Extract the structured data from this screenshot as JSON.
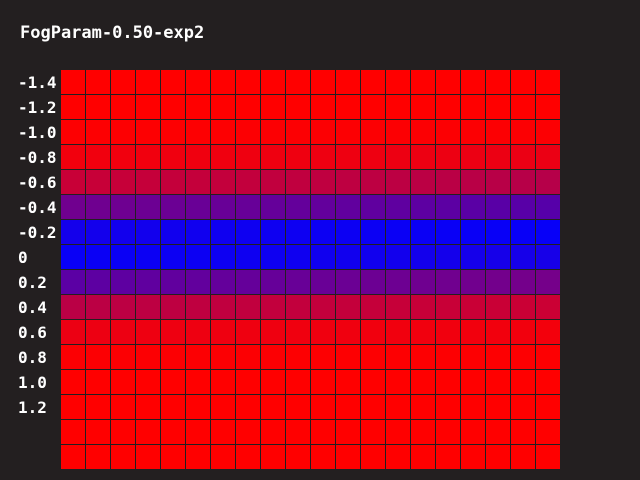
{
  "title": "FogParam-0.50-exp2",
  "row_labels": [
    "-1.4",
    "-1.2",
    "-1.0",
    "-0.8",
    "-0.6",
    "-0.4",
    "-0.2",
    "0",
    "0.2",
    "0.4",
    "0.6",
    "0.8",
    "1.0",
    "1.2",
    "",
    ""
  ],
  "grid": {
    "columns": 20,
    "rows": 16
  },
  "colors": {
    "fog_color": "#ff0000",
    "object_color": "#0000ff",
    "background": "#231f20",
    "text": "#ffffff"
  },
  "fog": {
    "density": 0.5,
    "mode": "exp2"
  }
}
